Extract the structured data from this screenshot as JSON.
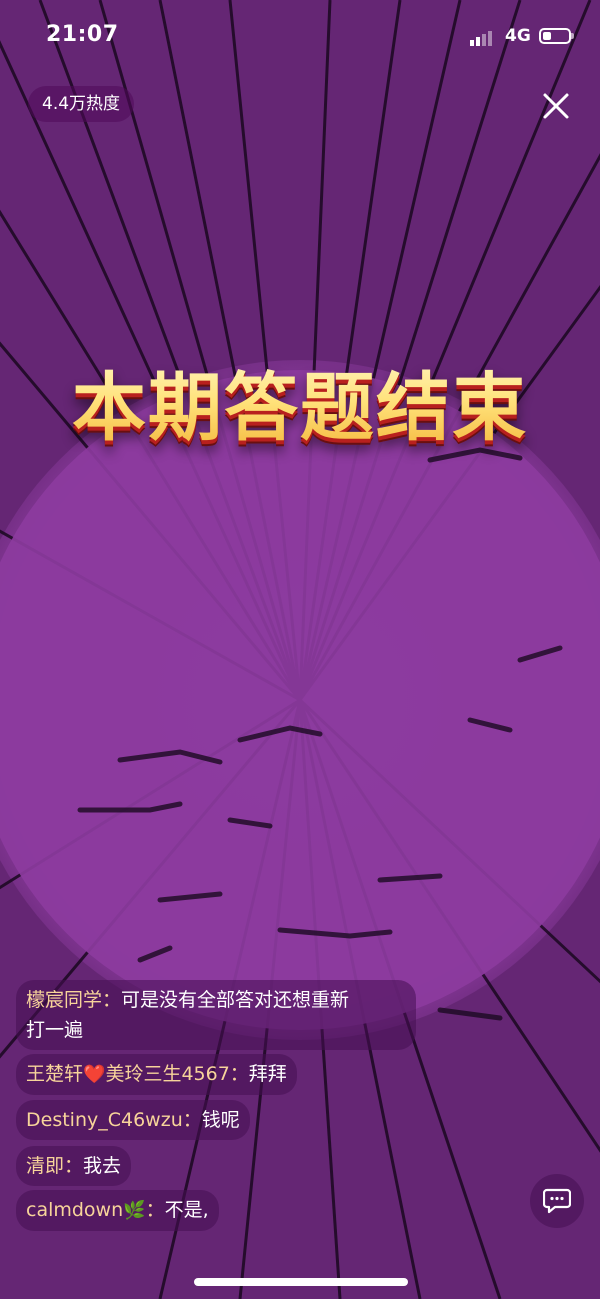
{
  "status_bar": {
    "time": "21:07",
    "network": "4G"
  },
  "header": {
    "heat": "4.4万热度"
  },
  "title": "本期答题结束",
  "chat": {
    "messages": [
      {
        "user": "檬宸同学：",
        "text_line1": "可是没有全部答对还想重新",
        "text_line2": "打一遍"
      },
      {
        "user": "王楚轩",
        "emoji": "❤️",
        "user2": "美玲三生4567：",
        "text": "拜拜"
      },
      {
        "user": "Destiny_C46wzu：",
        "text": "钱呢"
      },
      {
        "user": "清即：",
        "text": "我去"
      },
      {
        "user": "calmdown",
        "emoji": "🌿",
        "user_suffix": "：",
        "text": "不是,"
      }
    ]
  },
  "colors": {
    "background": "#6c2a7c",
    "username": "#f7d49a",
    "title_gold": "#ffe07a",
    "title_shadow": "#b8201e"
  },
  "icons": {
    "close": "close-icon",
    "comment": "comment-icon",
    "signal": "signal-icon",
    "battery": "battery-icon"
  }
}
